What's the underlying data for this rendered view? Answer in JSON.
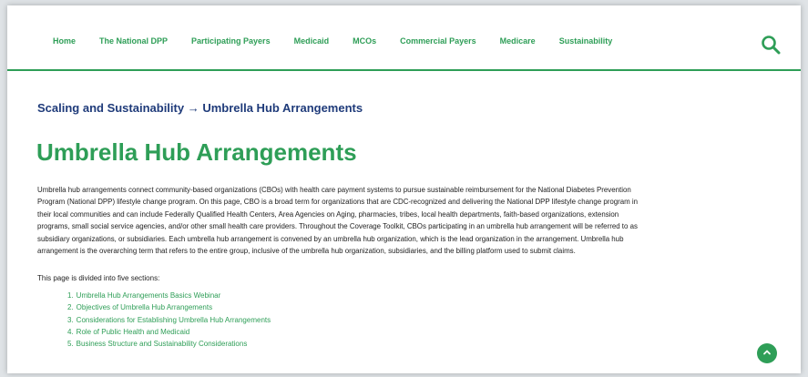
{
  "nav": {
    "items": [
      {
        "label": "Home"
      },
      {
        "label": "The National DPP"
      },
      {
        "label": "Participating Payers"
      },
      {
        "label": "Medicaid"
      },
      {
        "label": "MCOs"
      },
      {
        "label": "Commercial Payers"
      },
      {
        "label": "Medicare"
      },
      {
        "label": "Sustainability"
      }
    ],
    "search_icon": "search-icon"
  },
  "breadcrumb": "Scaling and Sustainability → Umbrella Hub Arrangements",
  "page_title": "Umbrella Hub Arrangements",
  "intro_lines": [
    "Umbrella hub arrangements connect community-based organizations (CBOs) with health care payment systems to pursue sustainable reimbursement for the National Diabetes Prevention",
    "Program (National DPP) lifestyle change program. On this page, CBO is a broad term for organizations that are CDC-recognized and delivering the National DPP lifestyle change program in",
    "their local communities and can include Federally Qualified Health Centers, Area Agencies on Aging, pharmacies, tribes, local health departments, faith-based organizations, extension",
    "programs, small social service agencies, and/or other small health care providers. Throughout the Coverage Toolkit, CBOs participating in an umbrella hub arrangement will be referred to as",
    "subsidiary organizations, or subsidiaries. Each umbrella hub arrangement is convened by an umbrella hub organization, which is the lead organization in the arrangement. Umbrella hub",
    "arrangement is the overarching term that refers to the entire group, inclusive of the umbrella hub organization, subsidiaries, and the billing platform used to submit claims."
  ],
  "divided_text": "This page is divided into five sections:",
  "sections": [
    {
      "num": "1.",
      "label": "Umbrella Hub Arrangements Basics Webinar"
    },
    {
      "num": "2.",
      "label": "Objectives of Umbrella Hub Arrangements"
    },
    {
      "num": "3.",
      "label": "Considerations for Establishing Umbrella Hub Arrangements"
    },
    {
      "num": "4.",
      "label": "Role of Public Health and Medicaid"
    },
    {
      "num": "5.",
      "label": "Business Structure and Sustainability Considerations"
    }
  ],
  "back_to_top_icon": "chevron-up-icon",
  "colors": {
    "accent_green": "#2e9e57",
    "breadcrumb_blue": "#1f3b7a"
  }
}
